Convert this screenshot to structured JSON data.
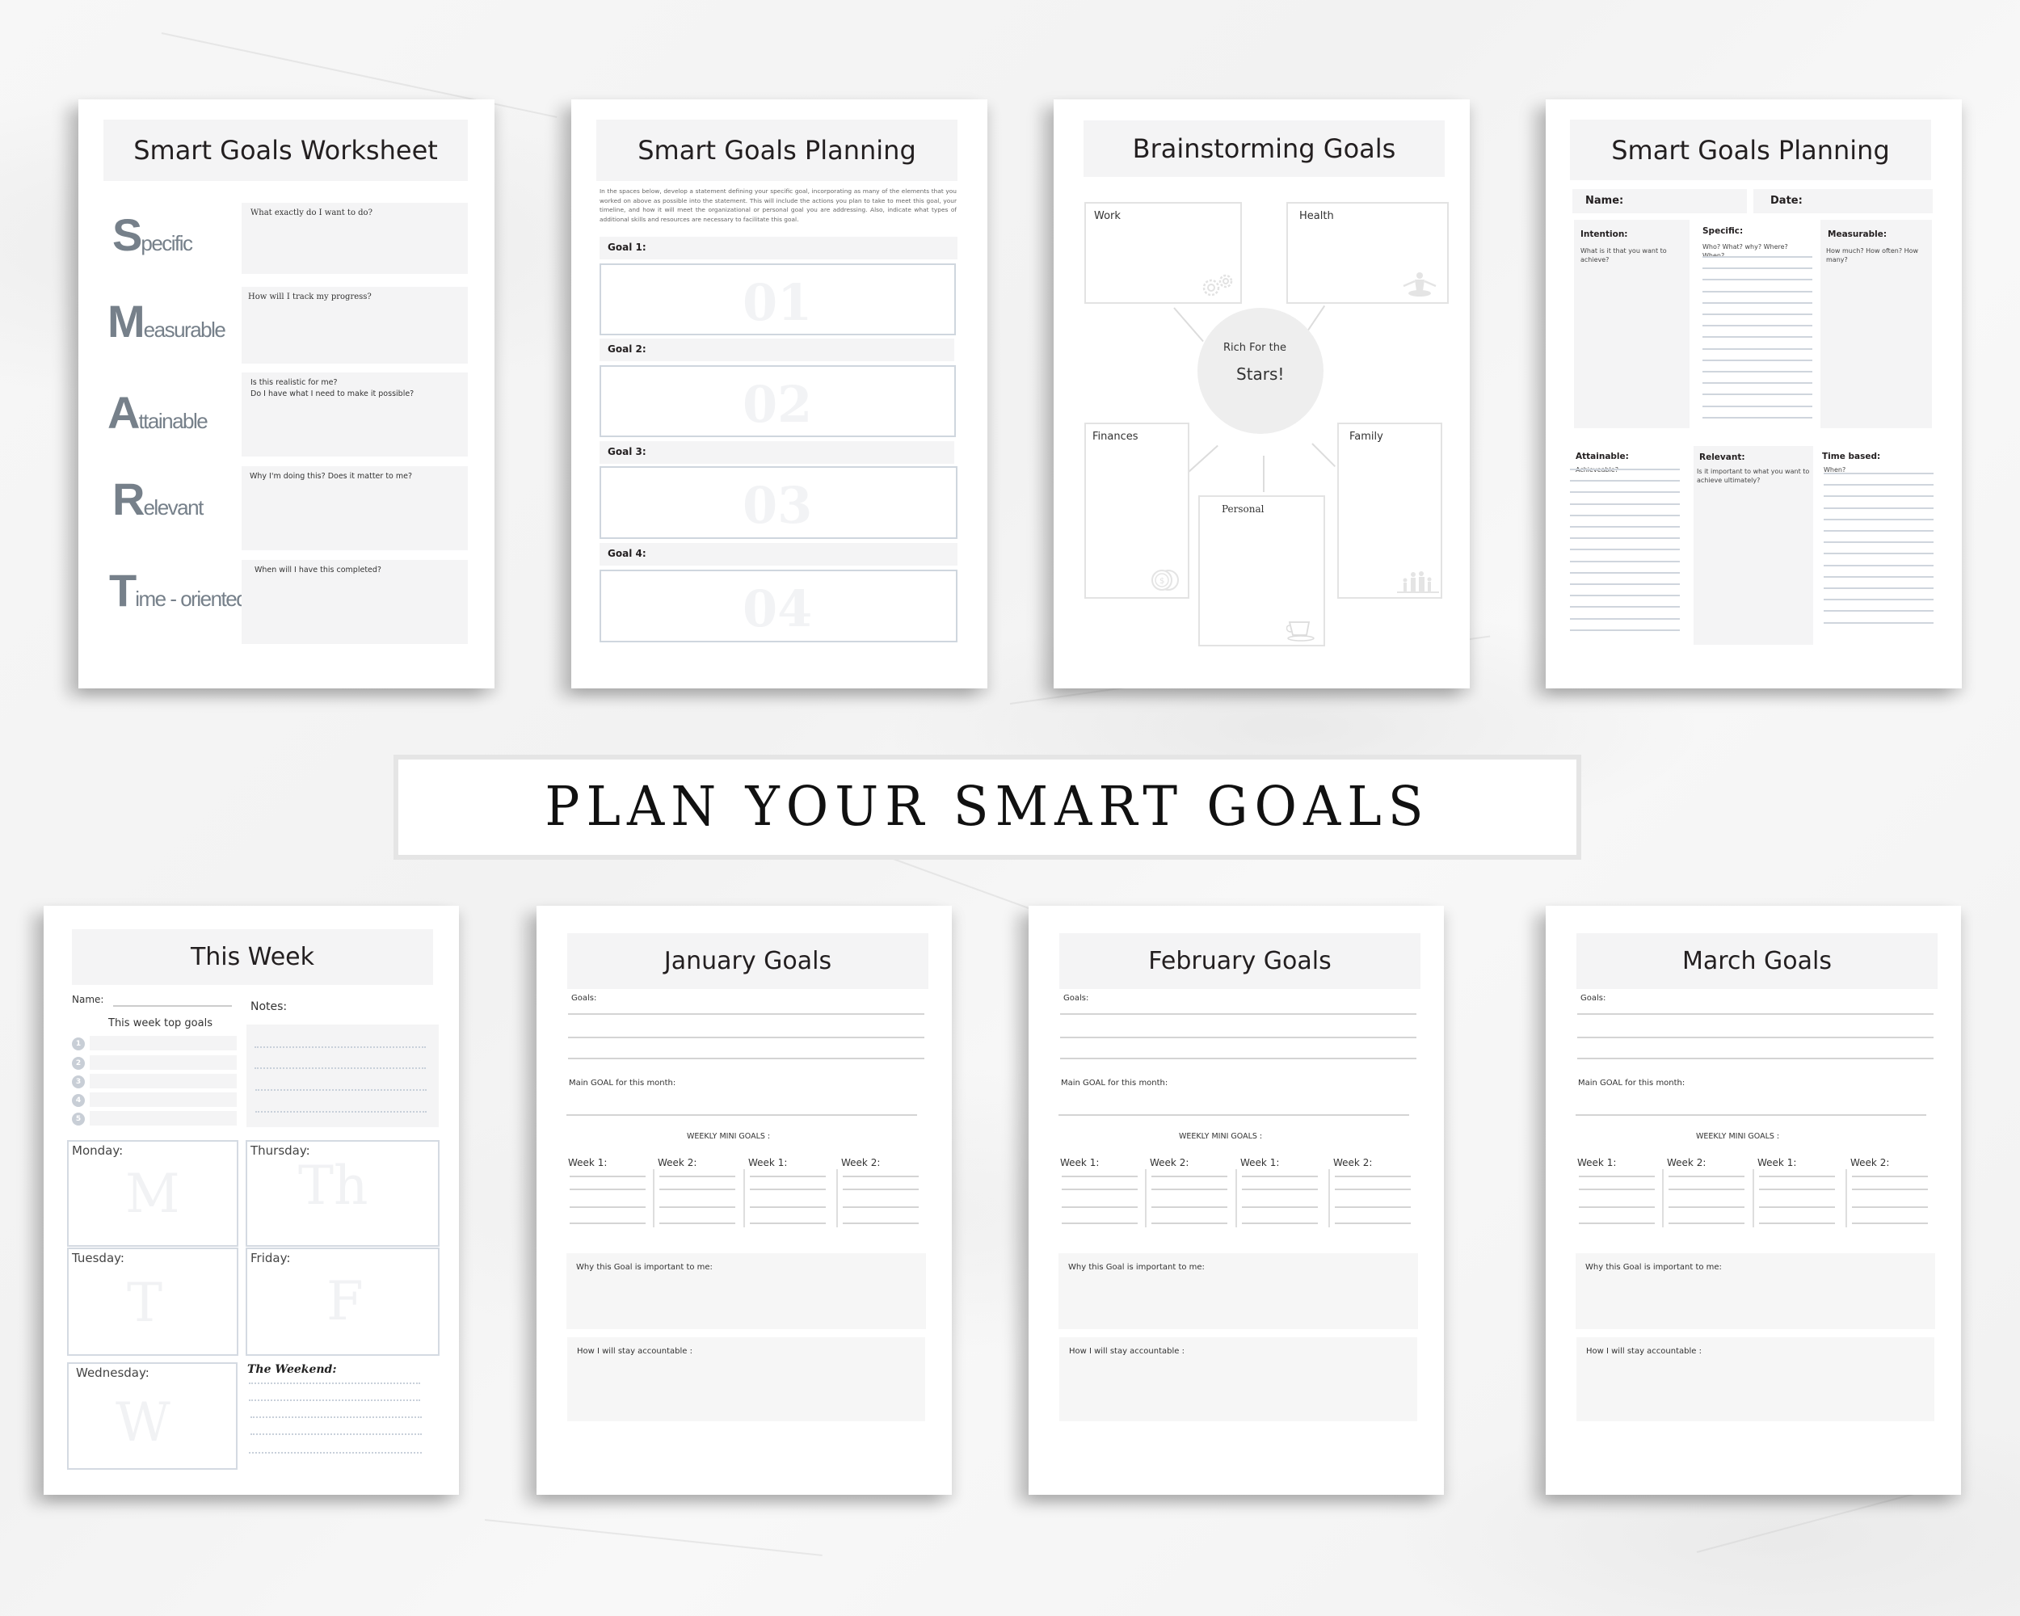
{
  "banner": {
    "title": "PLAN YOUR SMART GOALS"
  },
  "worksheet": {
    "title": "Smart Goals Worksheet",
    "rows": [
      {
        "letter": "S",
        "rest": "pecific",
        "prompt": "What exactly do I want to do?"
      },
      {
        "letter": "M",
        "rest": "easurable",
        "prompt": "How will I track my progress?"
      },
      {
        "letter": "A",
        "rest": "ttainable",
        "prompt": "Is this realistic for me?\nDo I have what I need to make it possible?"
      },
      {
        "letter": "R",
        "rest": "elevant",
        "prompt": "Why I'm doing this? Does it matter to me?"
      },
      {
        "letter": "T",
        "rest": "ime - oriented",
        "prompt": "When will I have this completed?"
      }
    ]
  },
  "planning1": {
    "title": "Smart Goals Planning",
    "intro": "In the spaces below, develop a statement defining your specific goal, incorporating as many of the elements that you worked on above as possible into the statement. This will include the actions you plan to take to meet this goal, your timeline, and how it will meet the organizational or personal goal you are addressing. Also, indicate what types of additional skills and resources are necessary to facilitate this goal.",
    "goals": [
      {
        "label": "Goal 1:",
        "number": "01"
      },
      {
        "label": "Goal 2:",
        "number": "02"
      },
      {
        "label": "Goal 3:",
        "number": "03"
      },
      {
        "label": "Goal 4:",
        "number": "04"
      }
    ]
  },
  "brainstorm": {
    "title": "Brainstorming Goals",
    "center_line1": "Rich For the",
    "center_line2": "Stars!",
    "boxes": {
      "work": {
        "label": "Work",
        "icon": "gears-icon"
      },
      "health": {
        "label": "Health",
        "icon": "meditation-icon"
      },
      "finances": {
        "label": "Finances",
        "icon": "coins-icon"
      },
      "personal": {
        "label": "Personal",
        "icon": "coffee-cup-icon"
      },
      "family": {
        "label": "Family",
        "icon": "family-icon"
      }
    }
  },
  "planning2": {
    "title": "Smart Goals Planning",
    "name_label": "Name:",
    "date_label": "Date:",
    "intention": {
      "title": "Intention:",
      "prompt": "What is it that you want to achieve?"
    },
    "specific": {
      "title": "Specific:",
      "prompt": "Who?  What? why? Where? When?"
    },
    "measurable": {
      "title": "Measurable:",
      "prompt": "How much? How often? How many?"
    },
    "attainable": {
      "title": "Attainable:",
      "prompt": "Achieveable?"
    },
    "relevant": {
      "title": "Relevant:",
      "prompt": "Is it important to what you want to achieve ultimately?"
    },
    "time_based": {
      "title": "Time based:",
      "prompt": "When?"
    }
  },
  "this_week": {
    "title": "This Week",
    "name_label": "Name:",
    "notes_label": "Notes:",
    "top_goals_label": "This week top goals",
    "goal_numbers": [
      "1",
      "2",
      "3",
      "4",
      "5"
    ],
    "days": {
      "monday": {
        "label": "Monday:",
        "glyph": "M"
      },
      "thursday": {
        "label": "Thursday:",
        "glyph": "Th"
      },
      "tuesday": {
        "label": "Tuesday:",
        "glyph": "T"
      },
      "friday": {
        "label": "Friday:",
        "glyph": "F"
      },
      "wednesday": {
        "label": "Wednesday:",
        "glyph": "W"
      }
    },
    "weekend_label": "The Weekend:"
  },
  "months": [
    {
      "title": "January Goals",
      "goals_label": "Goals:",
      "main_goal_label": "Main GOAL for this month:",
      "weekly_label": "WEEKLY MINI GOALS :",
      "weeks": [
        "Week 1:",
        "Week 2:",
        "Week 1:",
        "Week 2:"
      ],
      "why_label": "Why this Goal is important to me:",
      "accountable_label": "How I will stay accountable :"
    },
    {
      "title": "February Goals",
      "goals_label": "Goals:",
      "main_goal_label": "Main GOAL for this month:",
      "weekly_label": "WEEKLY MINI GOALS :",
      "weeks": [
        "Week 1:",
        "Week 2:",
        "Week 1:",
        "Week 2:"
      ],
      "why_label": "Why this Goal is important to me:",
      "accountable_label": "How I will stay accountable :"
    },
    {
      "title": "March Goals",
      "goals_label": "Goals:",
      "main_goal_label": "Main GOAL for this month:",
      "weekly_label": "WEEKLY MINI GOALS :",
      "weeks": [
        "Week 1:",
        "Week 2:",
        "Week 1:",
        "Week 2:"
      ],
      "why_label": "Why this Goal is important to me:",
      "accountable_label": "How I will stay accountable :"
    }
  ]
}
